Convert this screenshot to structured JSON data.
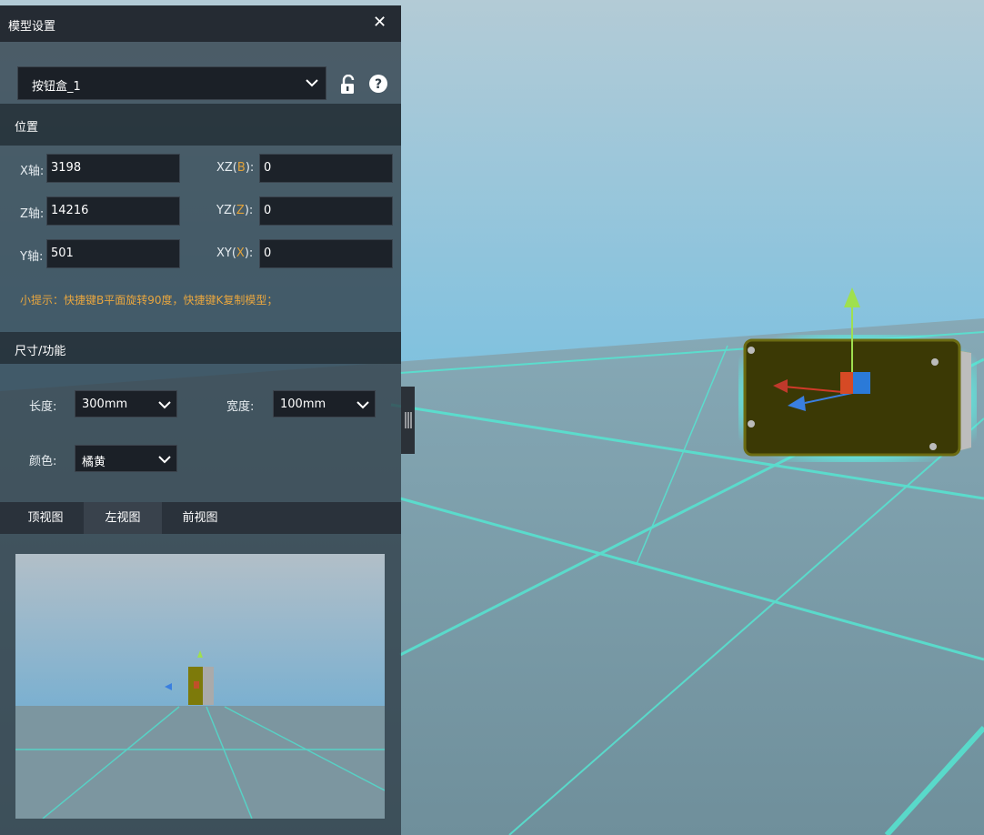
{
  "panel": {
    "title": "模型设置",
    "close_icon": "close-icon",
    "model_select": {
      "value": "按钮盒_1"
    },
    "lock_icon": "unlock-icon",
    "help_icon": "help-icon"
  },
  "position": {
    "section_label": "位置",
    "x_label": "X轴:",
    "x_value": "3198",
    "z_label": "Z轴:",
    "z_value": "14216",
    "y_label": "Y轴:",
    "y_value": "501",
    "xz_prefix": "XZ(",
    "xz_key": "B",
    "xz_suffix": "):",
    "xz_value": "0",
    "yz_prefix": "YZ(",
    "yz_key": "Z",
    "yz_suffix": "):",
    "yz_value": "0",
    "xy_prefix": "XY(",
    "xy_key": "X",
    "xy_suffix": "):",
    "xy_value": "0",
    "hint": "小提示：快捷键B平面旋转90度，快捷键K复制模型；"
  },
  "size": {
    "section_label": "尺寸/功能",
    "length_label": "长度:",
    "length_value": "300mm",
    "width_label": "宽度:",
    "width_value": "100mm",
    "color_label": "颜色:",
    "color_value": "橘黄"
  },
  "views": {
    "tabs": [
      "顶视图",
      "左视图",
      "前视图"
    ],
    "active": "左视图"
  },
  "colors": {
    "accent": "#e0a23a",
    "grid_line": "#3fe0cc",
    "box_body": "#3d3a05",
    "box_side": "#8a8a10",
    "sky": "#a8c6d4"
  }
}
